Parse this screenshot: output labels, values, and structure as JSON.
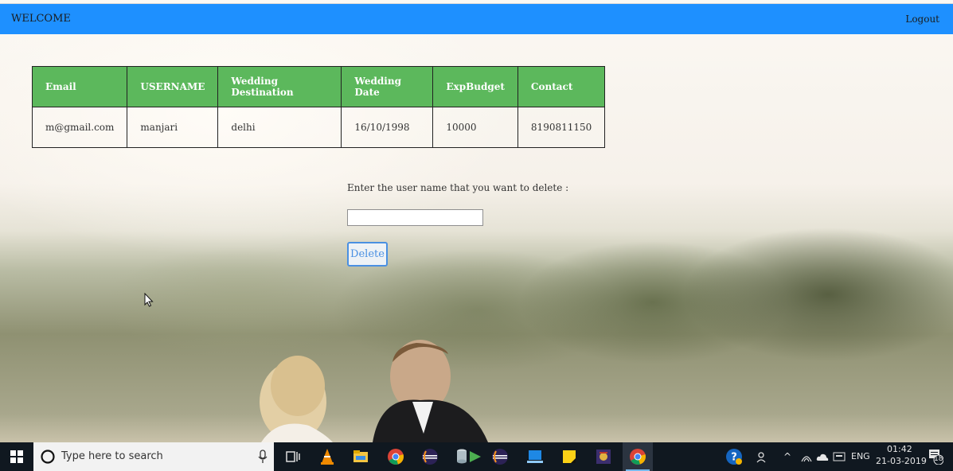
{
  "header": {
    "welcome": "WELCOME",
    "logout": "Logout",
    "bar_color": "#1e90ff"
  },
  "table": {
    "header_color": "#5cb85c",
    "columns": [
      "Email",
      "USERNAME",
      "Wedding Destination",
      "Wedding Date",
      "ExpBudget",
      "Contact"
    ],
    "rows": [
      [
        "m@gmail.com",
        "manjari",
        "delhi",
        "16/10/1998",
        "10000",
        "8190811150"
      ]
    ]
  },
  "delete_form": {
    "prompt": "Enter the user name that you want to delete :",
    "input_value": "",
    "button_label": "Delete"
  },
  "taskbar": {
    "search_placeholder": "Type here to search",
    "apps": [
      "task-view-icon",
      "vlc-icon",
      "file-explorer-icon",
      "chrome-icon",
      "eclipse-icon",
      "database-icon",
      "media-icon",
      "eclipse-icon",
      "remote-icon",
      "sticky-notes-icon",
      "game-icon",
      "chrome-icon"
    ],
    "language": "ENG",
    "time": "01:42",
    "date": "21-03-2019",
    "notification_count": "18"
  }
}
